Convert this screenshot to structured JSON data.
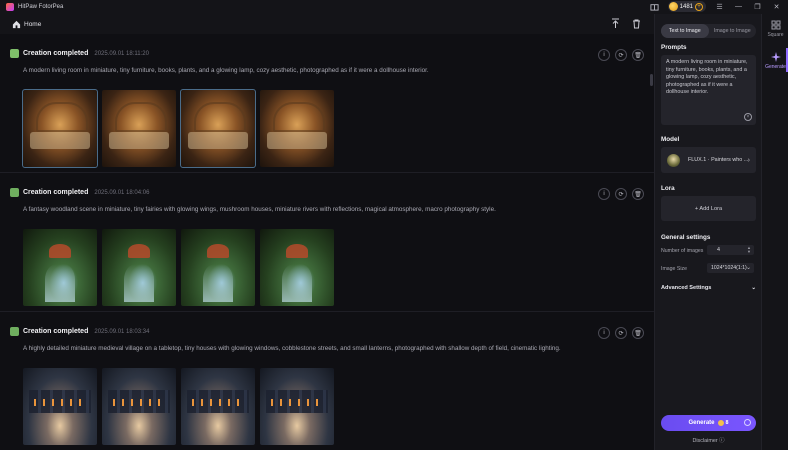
{
  "app": {
    "title": "HitPaw FotorPea"
  },
  "titlebar": {
    "credits": "1481"
  },
  "subheader": {
    "home_label": "Home"
  },
  "feed": {
    "cards": [
      {
        "title": "Creation completed",
        "timestamp": "2025.09.01 18:11:20",
        "prompt": "A modern living room in miniature, tiny furniture, books, plants, and a glowing lamp, cozy aesthetic, photographed as if it were a dollhouse interior.",
        "style": "interior"
      },
      {
        "title": "Creation completed",
        "timestamp": "2025.09.01 18:04:06",
        "prompt": "A fantasy woodland scene in miniature, tiny fairies with glowing wings, mushroom houses, miniature rivers with reflections, magical atmosphere, macro photography style.",
        "style": "woods"
      },
      {
        "title": "Creation completed",
        "timestamp": "2025.09.01 18:03:34",
        "prompt": "A highly detailed miniature medieval village on a tabletop, tiny houses with glowing windows, cobblestone streets, and small lanterns, photographed with shallow depth of field, cinematic lighting.",
        "style": "village"
      }
    ]
  },
  "panel": {
    "tabs": [
      {
        "label": "Text to Image",
        "active": true
      },
      {
        "label": "Image to Image",
        "active": false
      }
    ],
    "prompts_label": "Prompts",
    "prompt_text": "A modern living room in miniature, tiny furniture, books, plants, and a glowing lamp, cozy aesthetic, photographed as if it were a dollhouse interior.",
    "model_label": "Model",
    "model_name": "FLUX.1 · Painters who ...",
    "lora_label": "Lora",
    "add_lora": "+ Add Lora",
    "general_settings": "General settings",
    "num_images_label": "Number of images",
    "num_images_value": "4",
    "image_size_label": "Image Size",
    "image_size_value": "1024*1024(1:1)",
    "advanced_settings": "Advanced Settings",
    "generate_label": "Generate",
    "generate_cost": "8",
    "disclaimer": "Disclaimer ⓘ"
  },
  "rail": {
    "items": [
      {
        "label": "Square"
      },
      {
        "label": "Generate"
      }
    ]
  },
  "colors": {
    "accent": "#7a56ff",
    "background": "#0f0f13",
    "panel": "#18181d"
  }
}
